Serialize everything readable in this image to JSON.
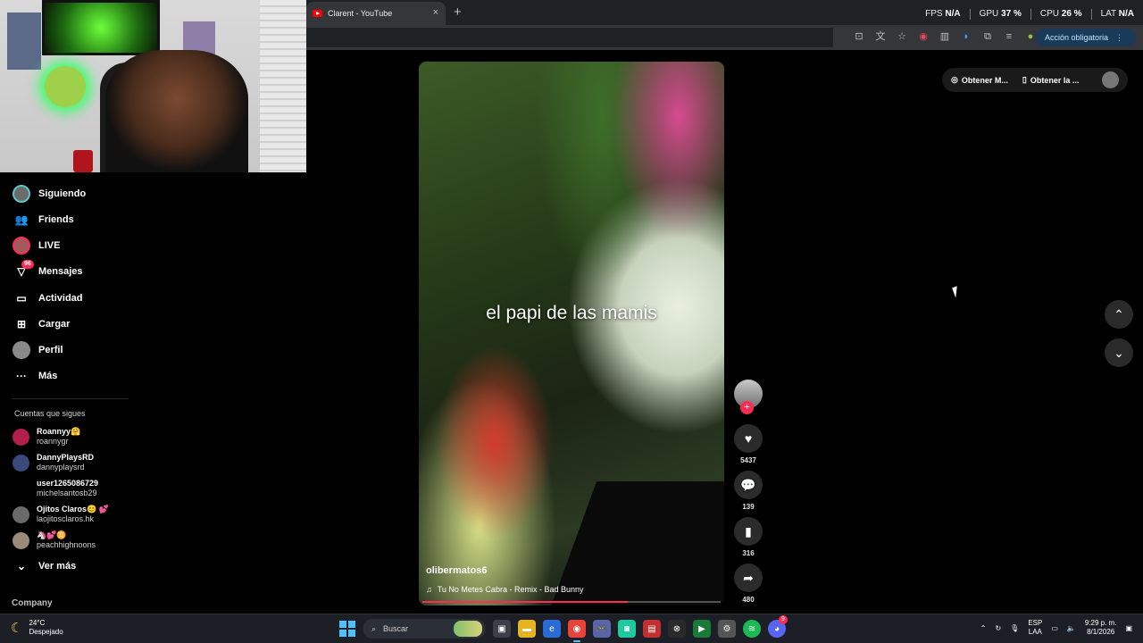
{
  "browser": {
    "tab_title": "Clarent - YouTube",
    "tab_close": "×",
    "new_tab": "+",
    "action_button": "Acción obligatoria"
  },
  "overlay_stats": {
    "fps_label": "FPS",
    "fps_value": "N/A",
    "gpu_label": "GPU",
    "gpu_value": "37 %",
    "cpu_label": "CPU",
    "cpu_value": "26 %",
    "lat_label": "LAT",
    "lat_value": "N/A"
  },
  "sidebar": {
    "items": [
      {
        "label": "Siguiendo",
        "icon": "following-avatar-icon"
      },
      {
        "label": "Friends",
        "icon": "friends-icon"
      },
      {
        "label": "LIVE",
        "icon": "live-icon"
      },
      {
        "label": "Mensajes",
        "icon": "messages-icon",
        "badge": "96"
      },
      {
        "label": "Actividad",
        "icon": "activity-icon"
      },
      {
        "label": "Cargar",
        "icon": "upload-icon"
      },
      {
        "label": "Perfil",
        "icon": "profile-icon"
      },
      {
        "label": "Más",
        "icon": "more-icon"
      }
    ],
    "following_title": "Cuentas que sigues",
    "accounts": [
      {
        "name": "Roannyy🤗",
        "handle": "roannygr"
      },
      {
        "name": "DannyPlaysRD",
        "handle": "dannyplaysrd"
      },
      {
        "name": "user1265086729",
        "handle": "michelsantosb29"
      },
      {
        "name": "Ojitos Claros😊 💕",
        "handle": "laojitosclaros.hk"
      },
      {
        "name": "🦄💕♊",
        "handle": "peachhighnoons"
      }
    ],
    "see_more": "Ver más",
    "company": "Company"
  },
  "video": {
    "caption": "el papi de las mamis",
    "author": "olibermatos6",
    "music": "Tu No Metes Cabra - Remix - Bad Bunny",
    "progress": 0.69
  },
  "actions": {
    "likes": "5437",
    "comments": "139",
    "saves": "316",
    "shares": "480"
  },
  "top_pill": {
    "item1": "Obtener M...",
    "item2": "Obtener la ..."
  },
  "taskbar": {
    "temp": "24°C",
    "weather": "Despejado",
    "search": "Buscar",
    "lang1": "ESP",
    "lang2": "LAA",
    "time": "9:29 p. m.",
    "date": "8/1/2026",
    "discord_badge": "9"
  }
}
